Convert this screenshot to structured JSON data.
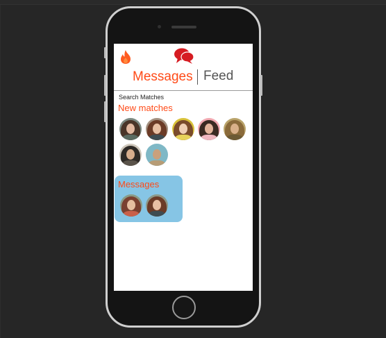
{
  "app": {
    "tabs": {
      "messages": "Messages",
      "feed": "Feed"
    },
    "search": {
      "label": "Search Matches"
    },
    "sections": {
      "new_matches": "New matches",
      "messages": "Messages"
    },
    "new_matches_count": 7,
    "message_threads_count": 2,
    "colors": {
      "accent": "#ff4a17",
      "chat_icon": "#d61c22",
      "messages_panel": "#86c5e5"
    },
    "icons": [
      "flame-icon",
      "chat-bubbles-icon"
    ]
  }
}
